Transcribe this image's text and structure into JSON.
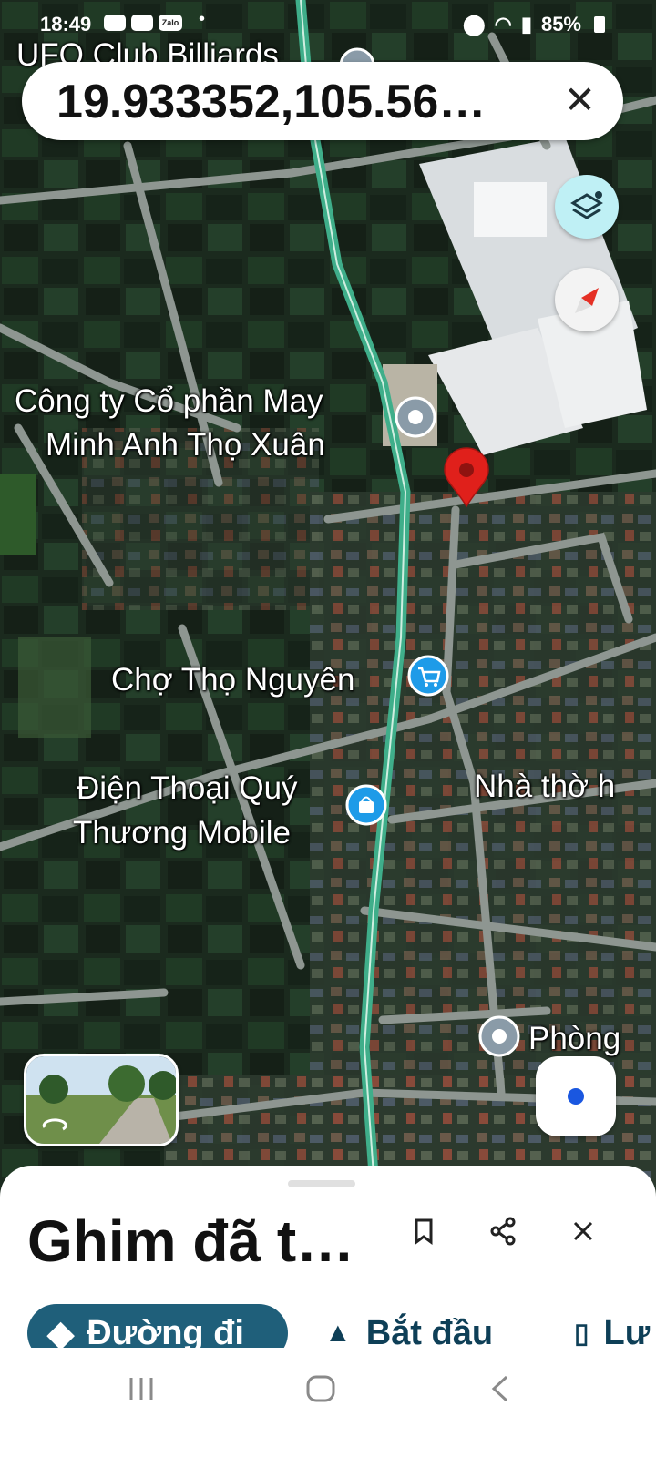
{
  "status_bar": {
    "time": "18:49",
    "app_icons": [
      "youtube-icon",
      "youtube-icon",
      "zalo-icon"
    ],
    "zalo_label": "Zalo",
    "dot": "•",
    "battery": "85%"
  },
  "search": {
    "query": "19.933352,105.56…"
  },
  "map": {
    "places": {
      "top_place": "UFO Club Billiards",
      "company_line1": "Công ty Cổ phần May",
      "company_line2": "Minh Anh Thọ Xuân",
      "market": "Chợ Thọ Nguyên",
      "phone_shop_line1": "Điện Thoại Quý",
      "phone_shop_line2": "Thương Mobile",
      "church": "Nhà thờ h",
      "room": "Phòng"
    },
    "colors": {
      "pin": "#e0201b",
      "place_pin": "#8a9ba8",
      "shop_pin": "#1e9be8",
      "road": "#8e9691",
      "highway": "#3fae8a"
    }
  },
  "sheet": {
    "title": "Ghim đã t…",
    "directions": "Đường đi",
    "start": "Bắt đầu",
    "save": "Lư"
  },
  "nav_icons": [
    "recent-apps-icon",
    "home-icon",
    "back-icon"
  ]
}
